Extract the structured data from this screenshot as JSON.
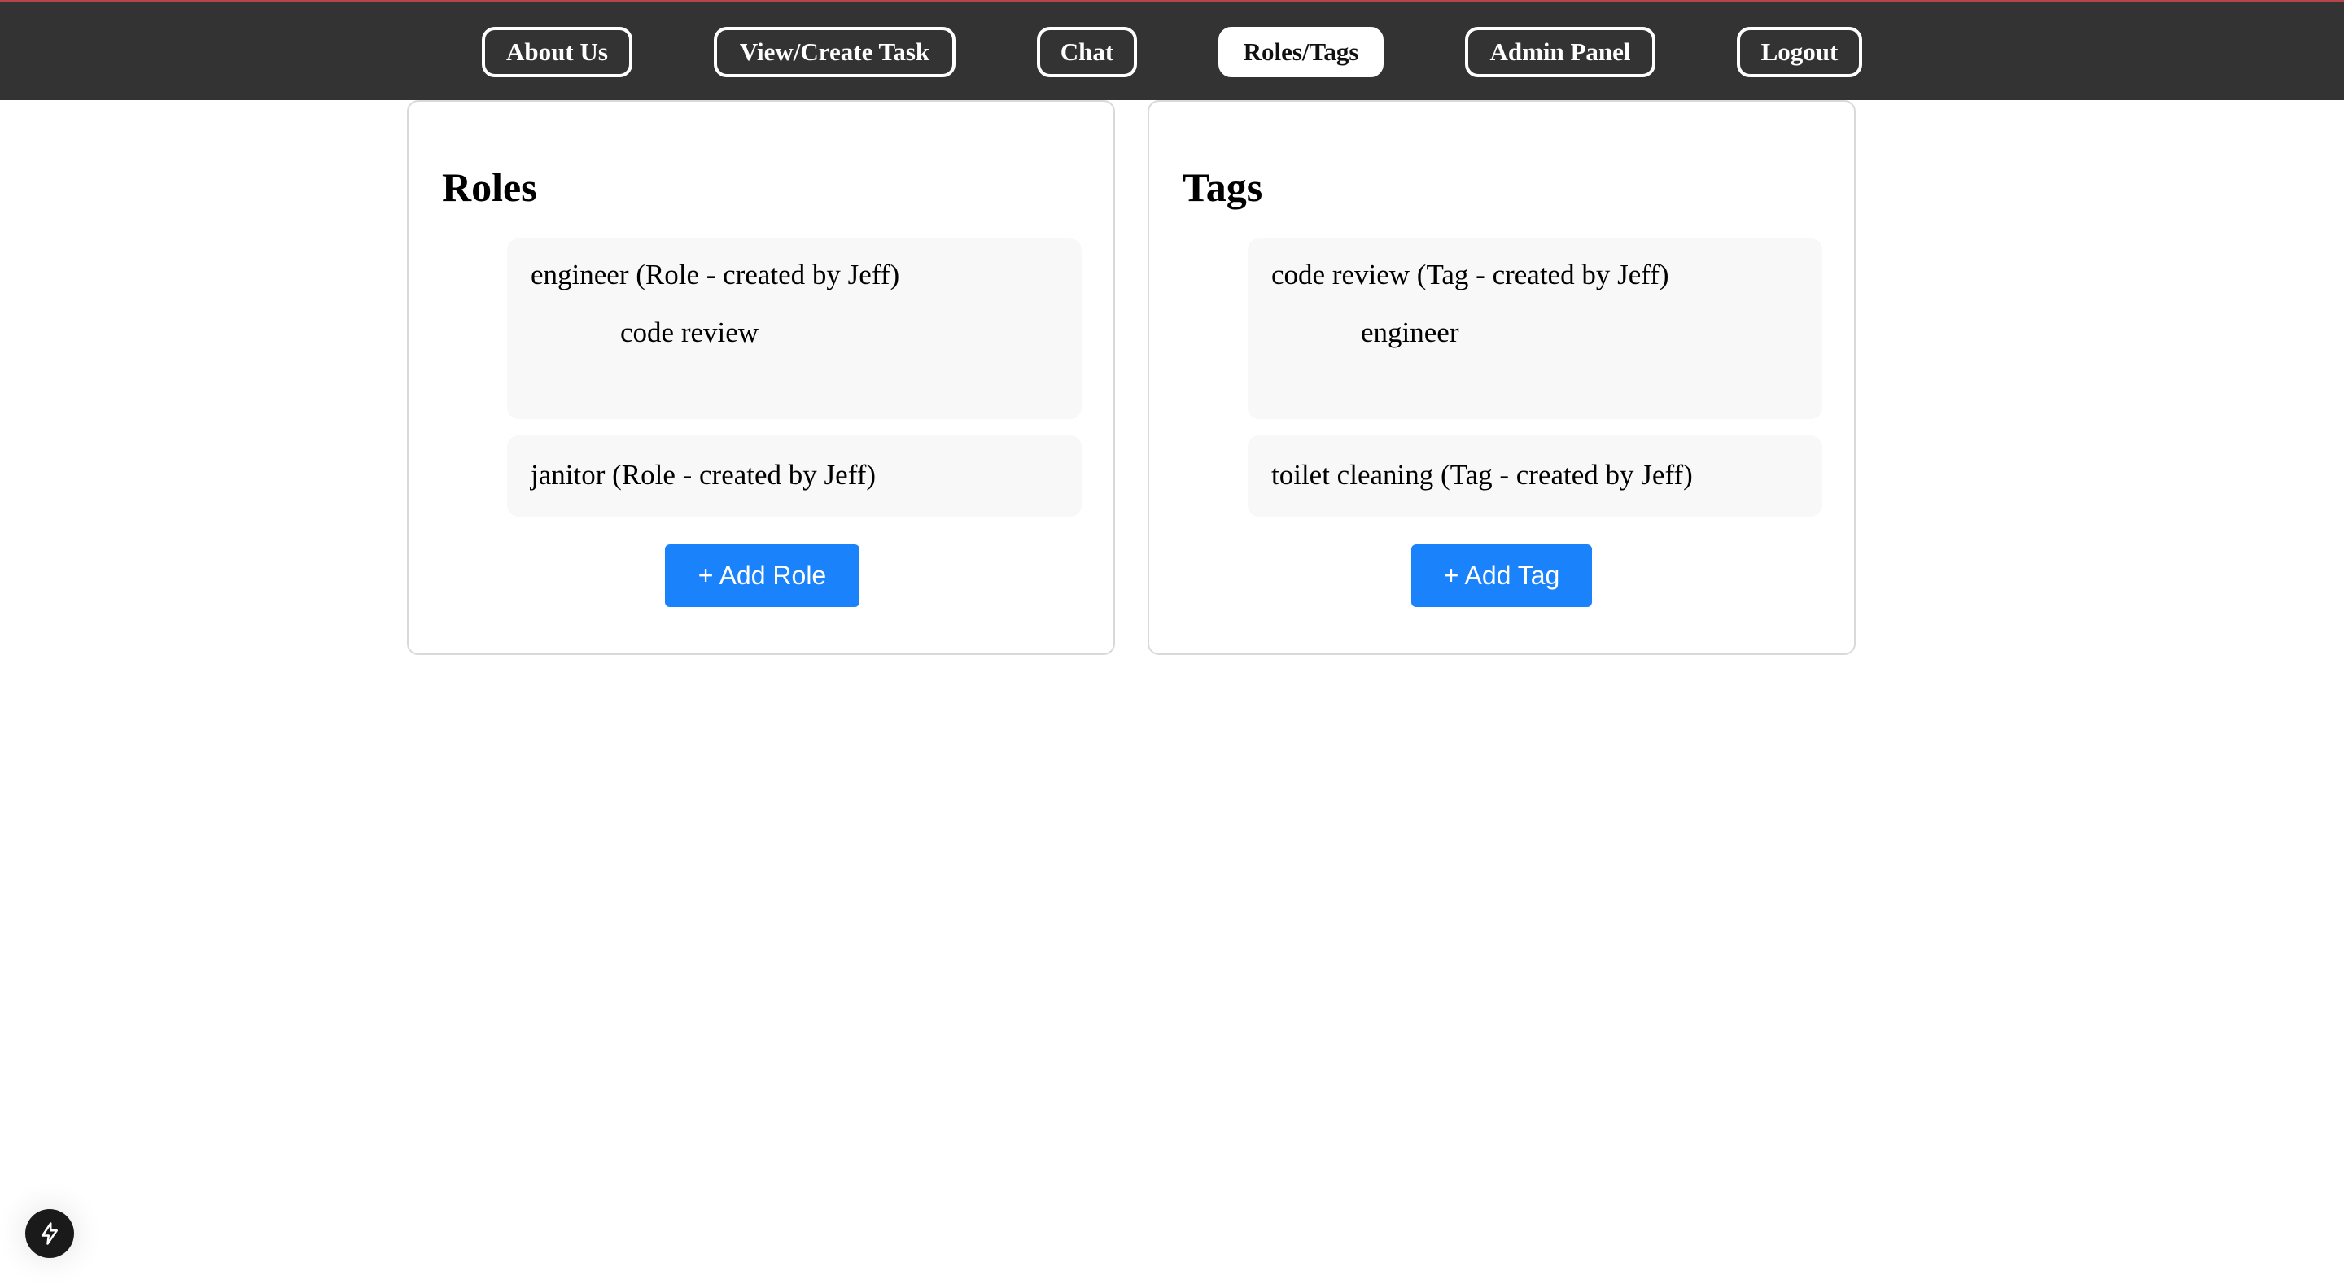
{
  "nav": {
    "items": [
      {
        "label": "About Us",
        "active": false
      },
      {
        "label": "View/Create Task",
        "active": false
      },
      {
        "label": "Chat",
        "active": false
      },
      {
        "label": "Roles/Tags",
        "active": true
      },
      {
        "label": "Admin Panel",
        "active": false
      },
      {
        "label": "Logout",
        "active": false
      }
    ]
  },
  "roles": {
    "title": "Roles",
    "items": [
      {
        "label": "engineer (Role - created by Jeff)",
        "sub": "code review"
      },
      {
        "label": "janitor (Role - created by Jeff)",
        "sub": ""
      }
    ],
    "add_label": "+ Add Role"
  },
  "tags": {
    "title": "Tags",
    "items": [
      {
        "label": "code review (Tag - created by Jeff)",
        "sub": "engineer"
      },
      {
        "label": "toilet cleaning (Tag - created by Jeff)",
        "sub": ""
      }
    ],
    "add_label": "+ Add Tag"
  },
  "colors": {
    "navbar_bg": "#333333",
    "accent": "#1a82fb",
    "item_bg": "#f8f8f8",
    "panel_border": "#d9d9d9"
  },
  "icons": {
    "dev_indicator": "lightning-bolt-icon"
  }
}
